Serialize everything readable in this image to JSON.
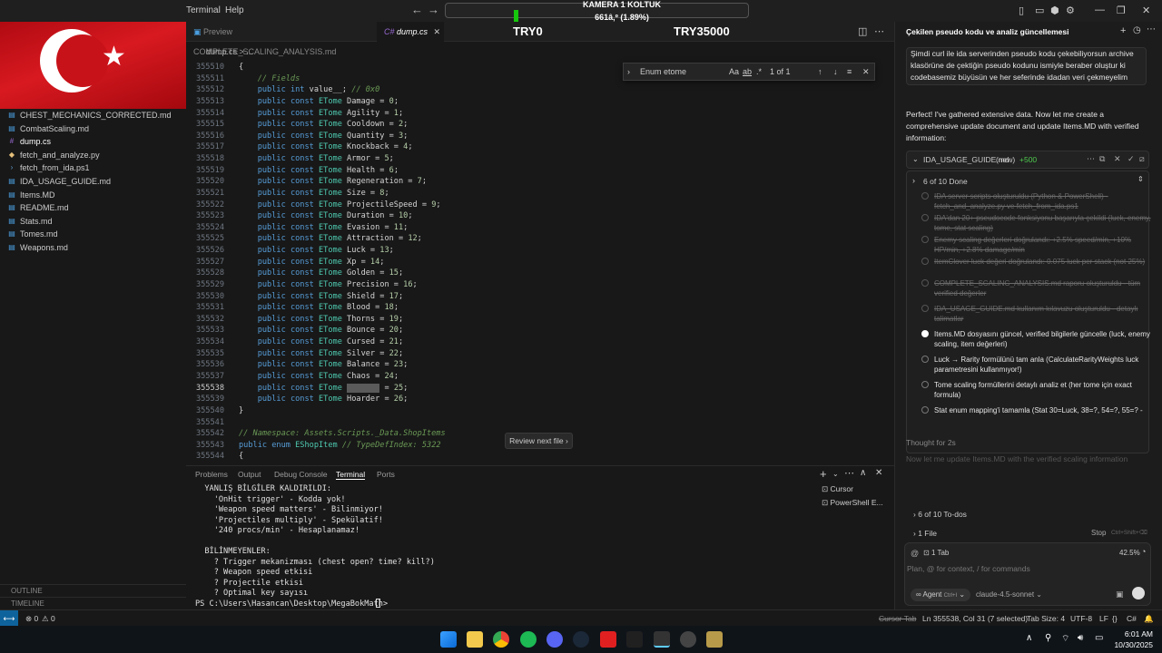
{
  "menu": {
    "terminal": "Terminal",
    "help": "Help"
  },
  "overlay": {
    "title": "KAMERA 1 KOLTUK",
    "score": "661â‚º (1.89%)",
    "try_left": "TRY0",
    "try_right": "TRY35000"
  },
  "tabs": [
    {
      "label": "Preview COMPLETE_SCALING_ANALYSIS.md"
    },
    {
      "label": "dump.cs"
    }
  ],
  "breadcrumb": "dump.cs > ...",
  "files": [
    {
      "name": "CHEST_MECHANICS_CORRECTED.md",
      "icon": "markdown-icon"
    },
    {
      "name": "CombatScaling.md",
      "icon": "markdown-icon"
    },
    {
      "name": "dump.cs",
      "icon": "csharp-icon"
    },
    {
      "name": "fetch_and_analyze.py",
      "icon": "python-icon"
    },
    {
      "name": "fetch_from_ida.ps1",
      "icon": "powershell-icon"
    },
    {
      "name": "IDA_USAGE_GUIDE.md",
      "icon": "markdown-icon"
    },
    {
      "name": "Items.MD",
      "icon": "markdown-icon"
    },
    {
      "name": "README.md",
      "icon": "markdown-icon"
    },
    {
      "name": "Stats.md",
      "icon": "markdown-icon"
    },
    {
      "name": "Tomes.md",
      "icon": "markdown-icon"
    },
    {
      "name": "Weapons.md",
      "icon": "markdown-icon"
    }
  ],
  "sections": {
    "outline": "OUTLINE",
    "timeline": "TIMELINE"
  },
  "code": [
    {
      "n": "355510",
      "t": "{"
    },
    {
      "n": "355511",
      "t": "    // Fields"
    },
    {
      "n": "355512",
      "t": "    public int value__; // 0x0"
    },
    {
      "n": "355513",
      "t": "    public const ETome Damage = 0;"
    },
    {
      "n": "355514",
      "t": "    public const ETome Agility = 1;"
    },
    {
      "n": "355515",
      "t": "    public const ETome Cooldown = 2;"
    },
    {
      "n": "355516",
      "t": "    public const ETome Quantity = 3;"
    },
    {
      "n": "355517",
      "t": "    public const ETome Knockback = 4;"
    },
    {
      "n": "355518",
      "t": "    public const ETome Armor = 5;"
    },
    {
      "n": "355519",
      "t": "    public const ETome Health = 6;"
    },
    {
      "n": "355520",
      "t": "    public const ETome Regeneration = 7;"
    },
    {
      "n": "355521",
      "t": "    public const ETome Size = 8;"
    },
    {
      "n": "355522",
      "t": "    public const ETome ProjectileSpeed = 9;"
    },
    {
      "n": "355523",
      "t": "    public const ETome Duration = 10;"
    },
    {
      "n": "355524",
      "t": "    public const ETome Evasion = 11;"
    },
    {
      "n": "355525",
      "t": "    public const ETome Attraction = 12;"
    },
    {
      "n": "355526",
      "t": "    public const ETome Luck = 13;"
    },
    {
      "n": "355527",
      "t": "    public const ETome Xp = 14;"
    },
    {
      "n": "355528",
      "t": "    public const ETome Golden = 15;"
    },
    {
      "n": "355529",
      "t": "    public const ETome Precision = 16;"
    },
    {
      "n": "355530",
      "t": "    public const ETome Shield = 17;"
    },
    {
      "n": "355531",
      "t": "    public const ETome Blood = 18;"
    },
    {
      "n": "355532",
      "t": "    public const ETome Thorns = 19;"
    },
    {
      "n": "355533",
      "t": "    public const ETome Bounce = 20;"
    },
    {
      "n": "355534",
      "t": "    public const ETome Cursed = 21;"
    },
    {
      "n": "355535",
      "t": "    public const ETome Silver = 22;"
    },
    {
      "n": "355536",
      "t": "    public const ETome Balance = 23;"
    },
    {
      "n": "355537",
      "t": "    public const ETome Chaos = 24;"
    },
    {
      "n": "355538",
      "t": "    public const ETome Gambler = 25;"
    },
    {
      "n": "355539",
      "t": "    public const ETome Hoarder = 26;"
    },
    {
      "n": "355540",
      "t": "}"
    },
    {
      "n": "355541",
      "t": ""
    },
    {
      "n": "355542",
      "t": "// Namespace: Assets.Scripts._Data.ShopItems"
    },
    {
      "n": "355543",
      "t": "public enum EShopItem // TypeDefIndex: 5322"
    },
    {
      "n": "355544",
      "t": "{"
    }
  ],
  "find": {
    "query": "Enum etome",
    "count": "1 of 1",
    "case": "Aa",
    "word": "ab"
  },
  "review_button": "Review next file",
  "panel_tabs": [
    "Problems",
    "Output",
    "Debug Console",
    "Terminal",
    "Ports"
  ],
  "terminal_lines": [
    "  YANLIŞ BİLGİLER KALDIRILDI:",
    "    'OnHit trigger' - Kodda yok!",
    "    'Weapon speed matters' - Bilinmiyor!",
    "    'Projectiles multiply' - Spekülatif!",
    "    '240 procs/min' - Hesaplanamaz!",
    "",
    "  BİLİNMEYENLER:",
    "    ? Trigger mekanizması (chest open? time? kill?)",
    "    ? Weapon speed etkisi",
    "    ? Projectile etkisi",
    "    ? Optimal key sayısı",
    "PS C:\\Users\\Hasancan\\Desktop\\MegaBokMath> "
  ],
  "terminals": [
    {
      "label": "Cursor"
    },
    {
      "label": "PowerShell E..."
    }
  ],
  "status": {
    "errors": "0",
    "warnings": "0",
    "cursor_tab": "Cursor Tab",
    "position": "Ln 355538, Col 31 (7 selected)",
    "tab_size": "Tab Size: 4",
    "encoding": "UTF-8",
    "eol": "LF",
    "lang": "C#"
  },
  "chat": {
    "title": "Çekilen pseudo kodu ve analiz güncellemesi",
    "user_msg": "Şimdi curl ile ida serverinden pseudo kodu çekebiliyorsun archive klasörüne de çektiğin pseudo kodunu ismiyle beraber oluştur ki codebasemiz büyüsün ve her seferinde idadan veri çekmeyelim",
    "reply": "Perfect! I've gathered extensive data. Now let me create a comprehensive update document and update Items.MD with verified information:",
    "file_card": {
      "name": "IDA_USAGE_GUIDE.md",
      "tag": "(new)",
      "diff": "+500"
    },
    "todo_header": "6 of 10 Done",
    "todos": [
      {
        "text": "IDA server scripts oluşturuldu (Python & PowerShell) - fetch_and_analyze.py ve fetch_from_ida.ps1",
        "state": "done"
      },
      {
        "text": "IDA'dan 20+ pseudocode fonksiyonu başarıyla çekildi (luck, enemy, tome, stat scaling)",
        "state": "done"
      },
      {
        "text": "Enemy scaling değerleri doğrulandı: +2.5% speed/min, +10% HP/min, +2.8% damage/min",
        "state": "done"
      },
      {
        "text": "ItemClover luck değeri doğrulandı: 0.075 luck per stack (not 25%)",
        "state": "done"
      },
      {
        "text": "COMPLETE_SCALING_ANALYSIS.md raporu oluşturuldu - tüm verified değerler",
        "state": "done"
      },
      {
        "text": "IDA_USAGE_GUIDE.md kullanım kılavuzu oluşturuldu - detaylı talimatlar",
        "state": "done"
      },
      {
        "text": "Items.MD dosyasını güncel, verified bilgilerle güncelle (luck, enemy scaling, item değerleri)",
        "state": "current"
      },
      {
        "text": "Luck → Rarity formülünü tam anla (CalculateRarityWeights luck parametresini kullanmıyor!)",
        "state": "open"
      },
      {
        "text": "Tome scaling formüllerini detaylı analiz et (her tome için exact formula)",
        "state": "open"
      },
      {
        "text": "Stat enum mapping'i tamamla (Stat 30=Luck, 38=?, 54=?, 55=? -",
        "state": "open"
      }
    ],
    "thought": "Thought for 2s",
    "faded": "Now let me update Items.MD with the verified scaling information",
    "todos_row": "6 of 10 To-dos",
    "files_row": "1 File",
    "stop": "Stop",
    "stop_hint": "Ctrl+Shift+⌫",
    "tab_count": "1 Tab",
    "percent": "42.5%",
    "placeholder": "Plan, @ for context, / for commands",
    "agent": "Agent",
    "agent_hint": "Ctrl+I",
    "model": "claude-4.5-sonnet"
  },
  "taskbar": {
    "time": "6:01 AM",
    "date": "10/30/2025"
  }
}
